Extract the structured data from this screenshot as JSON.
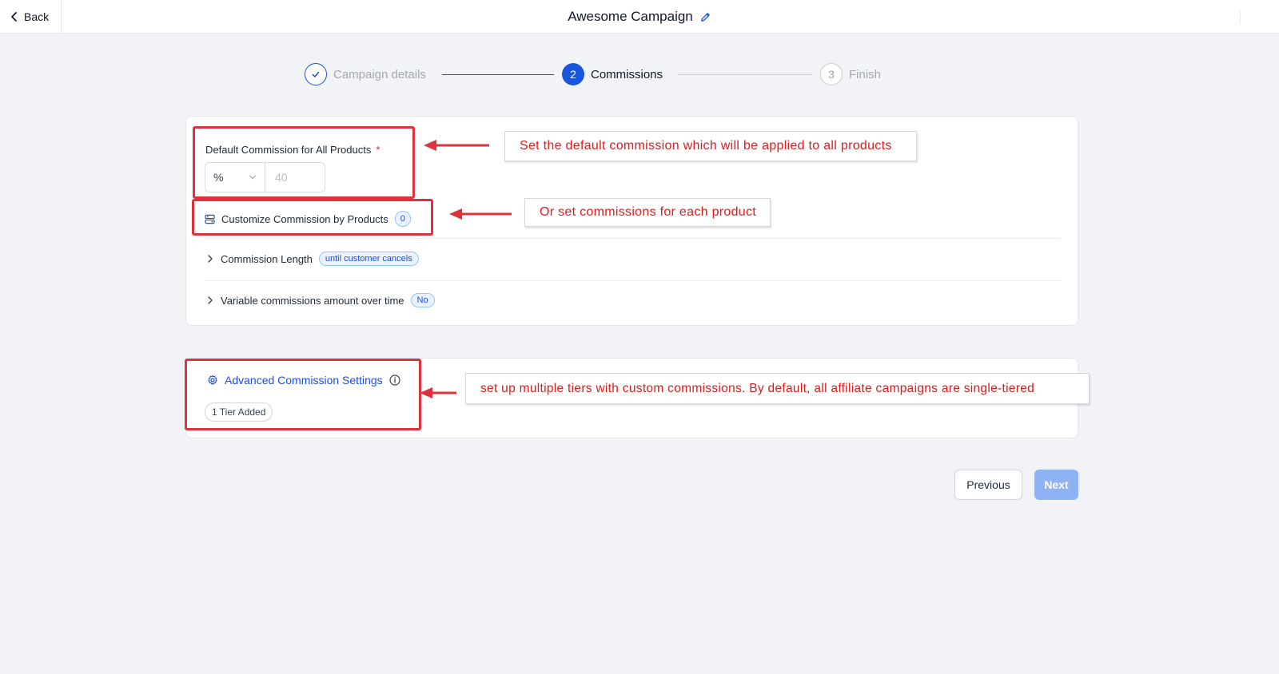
{
  "header": {
    "back_label": "Back",
    "title": "Awesome Campaign"
  },
  "stepper": {
    "steps": [
      {
        "number": "",
        "label": "Campaign details",
        "state": "done"
      },
      {
        "number": "2",
        "label": "Commissions",
        "state": "active"
      },
      {
        "number": "3",
        "label": "Finish",
        "state": "todo"
      }
    ]
  },
  "commission_card": {
    "default_label": "Default Commission for All Products",
    "required_mark": "*",
    "unit_value": "%",
    "amount_placeholder": "40",
    "customize_label": "Customize Commission by Products",
    "customize_count": "0",
    "length_label": "Commission Length",
    "length_badge": "until customer cancels",
    "variable_label": "Variable commissions amount over time",
    "variable_badge": "No"
  },
  "advanced_card": {
    "label": "Advanced Commission Settings",
    "tier_badge": "1 Tier Added"
  },
  "annotations": {
    "callout_default": "Set the default commission which will be applied to all products",
    "callout_products": "Or set commissions for each product",
    "callout_tiers": "set up multiple tiers with custom commissions. By default, all affiliate campaigns are single-tiered"
  },
  "footer": {
    "previous_label": "Previous",
    "next_label": "Next"
  },
  "colors": {
    "accent": "#1a56db",
    "annotation_red": "#e0323c",
    "next_disabled": "#8fb2f5"
  }
}
